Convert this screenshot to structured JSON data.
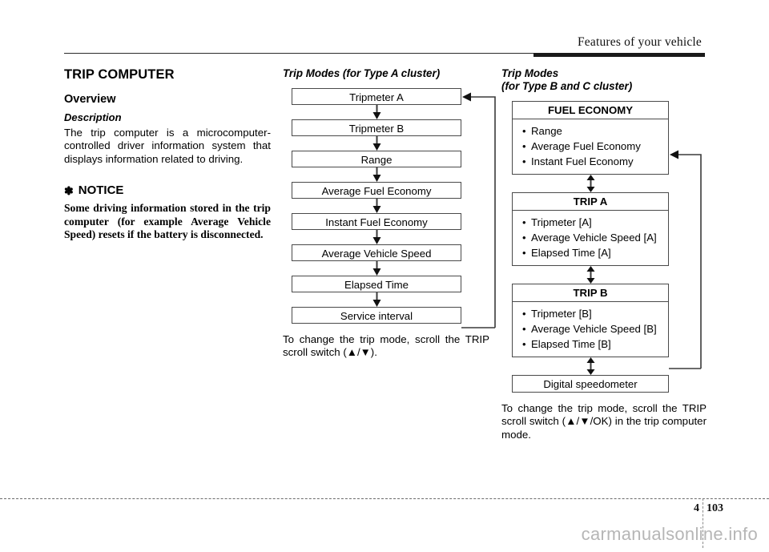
{
  "header": {
    "running_head": "Features of your vehicle"
  },
  "section": {
    "title": "TRIP COMPUTER"
  },
  "left_column": {
    "overview_heading": "Overview",
    "description_heading": "Description",
    "description_text": "The trip computer is a microcomputer-controlled driver information system that displays information related to driving.",
    "notice_symbol": "✽",
    "notice_heading": "NOTICE",
    "notice_text": "Some driving information stored in the trip computer (for example Average Vehicle Speed) resets if the battery is disconnected."
  },
  "middle_column": {
    "heading": "Trip Modes (for Type A cluster)",
    "flow_steps": [
      "Tripmeter A",
      "Tripmeter B",
      "Range",
      "Average Fuel Economy",
      "Instant Fuel Economy",
      "Average Vehicle Speed",
      "Elapsed Time",
      "Service interval"
    ],
    "caption": "To change the trip mode, scroll the TRIP scroll switch (▲/▼)."
  },
  "right_column": {
    "heading": "Trip Modes\n(for Type B and C cluster)",
    "groups": [
      {
        "title": "FUEL ECONOMY",
        "items": [
          "Range",
          "Average Fuel Economy",
          "Instant Fuel Economy"
        ]
      },
      {
        "title": "TRIP A",
        "items": [
          "Tripmeter [A]",
          "Average Vehicle Speed [A]",
          "Elapsed Time [A]"
        ]
      },
      {
        "title": "TRIP B",
        "items": [
          "Tripmeter [B]",
          "Average Vehicle Speed [B]",
          "Elapsed Time [B]"
        ]
      }
    ],
    "single_box": "Digital speedometer",
    "caption": "To change the trip mode, scroll the TRIP scroll switch (▲/▼/OK) in the trip computer mode."
  },
  "footer": {
    "chapter_number": "4",
    "page_number": "103",
    "watermark": "carmanualsonline.info"
  },
  "colors": {
    "ink": "#000000",
    "rule": "#2a2a2a",
    "box_border": "#4a4a4a",
    "watermark": "#b6b6b6"
  }
}
